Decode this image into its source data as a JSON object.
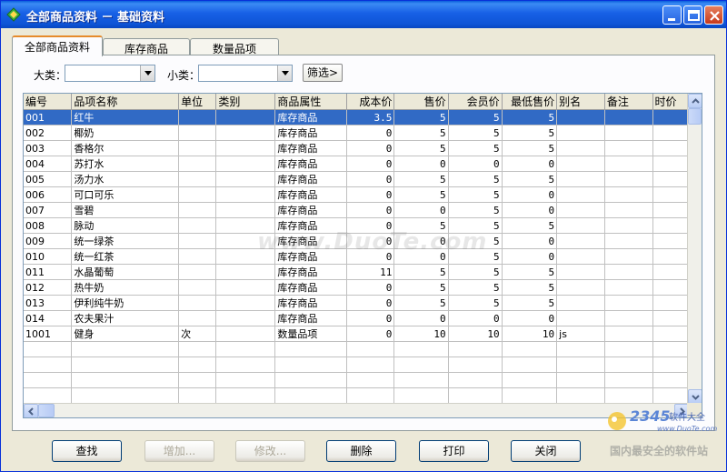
{
  "window": {
    "title": "全部商品资料 － 基础资料"
  },
  "tabs": [
    {
      "label": "全部商品资料",
      "active": true
    },
    {
      "label": "库存商品",
      "active": false
    },
    {
      "label": "数量品项",
      "active": false
    }
  ],
  "filters": {
    "major_label": "大类：",
    "major_value": "",
    "minor_label": "小类：",
    "minor_value": "",
    "filter_button": "筛选>"
  },
  "grid": {
    "columns": [
      "编号",
      "品项名称",
      "单位",
      "类别",
      "商品属性",
      "成本价",
      "售价",
      "会员价",
      "最低售价",
      "别名",
      "备注",
      "时价"
    ],
    "rows": [
      {
        "code": "001",
        "name": "红牛",
        "unit": "",
        "category": "",
        "attr": "库存商品",
        "cost": "3.5",
        "price": "5",
        "member": "5",
        "min": "5",
        "alias": "",
        "note": "",
        "timeprice": "",
        "selected": true
      },
      {
        "code": "002",
        "name": "椰奶",
        "unit": "",
        "category": "",
        "attr": "库存商品",
        "cost": "0",
        "price": "5",
        "member": "5",
        "min": "5",
        "alias": "",
        "note": "",
        "timeprice": ""
      },
      {
        "code": "003",
        "name": "香格尔",
        "unit": "",
        "category": "",
        "attr": "库存商品",
        "cost": "0",
        "price": "5",
        "member": "5",
        "min": "5",
        "alias": "",
        "note": "",
        "timeprice": ""
      },
      {
        "code": "004",
        "name": "苏打水",
        "unit": "",
        "category": "",
        "attr": "库存商品",
        "cost": "0",
        "price": "0",
        "member": "0",
        "min": "0",
        "alias": "",
        "note": "",
        "timeprice": ""
      },
      {
        "code": "005",
        "name": "汤力水",
        "unit": "",
        "category": "",
        "attr": "库存商品",
        "cost": "0",
        "price": "5",
        "member": "5",
        "min": "5",
        "alias": "",
        "note": "",
        "timeprice": ""
      },
      {
        "code": "006",
        "name": "可口可乐",
        "unit": "",
        "category": "",
        "attr": "库存商品",
        "cost": "0",
        "price": "5",
        "member": "5",
        "min": "0",
        "alias": "",
        "note": "",
        "timeprice": ""
      },
      {
        "code": "007",
        "name": "雪碧",
        "unit": "",
        "category": "",
        "attr": "库存商品",
        "cost": "0",
        "price": "0",
        "member": "5",
        "min": "0",
        "alias": "",
        "note": "",
        "timeprice": ""
      },
      {
        "code": "008",
        "name": "脉动",
        "unit": "",
        "category": "",
        "attr": "库存商品",
        "cost": "0",
        "price": "5",
        "member": "5",
        "min": "5",
        "alias": "",
        "note": "",
        "timeprice": ""
      },
      {
        "code": "009",
        "name": "统一绿茶",
        "unit": "",
        "category": "",
        "attr": "库存商品",
        "cost": "0",
        "price": "0",
        "member": "5",
        "min": "0",
        "alias": "",
        "note": "",
        "timeprice": ""
      },
      {
        "code": "010",
        "name": "统一红茶",
        "unit": "",
        "category": "",
        "attr": "库存商品",
        "cost": "0",
        "price": "0",
        "member": "5",
        "min": "0",
        "alias": "",
        "note": "",
        "timeprice": ""
      },
      {
        "code": "011",
        "name": "水晶葡萄",
        "unit": "",
        "category": "",
        "attr": "库存商品",
        "cost": "11",
        "price": "5",
        "member": "5",
        "min": "5",
        "alias": "",
        "note": "",
        "timeprice": ""
      },
      {
        "code": "012",
        "name": "热牛奶",
        "unit": "",
        "category": "",
        "attr": "库存商品",
        "cost": "0",
        "price": "5",
        "member": "5",
        "min": "5",
        "alias": "",
        "note": "",
        "timeprice": ""
      },
      {
        "code": "013",
        "name": "伊利纯牛奶",
        "unit": "",
        "category": "",
        "attr": "库存商品",
        "cost": "0",
        "price": "5",
        "member": "5",
        "min": "5",
        "alias": "",
        "note": "",
        "timeprice": ""
      },
      {
        "code": "014",
        "name": "农夫果汁",
        "unit": "",
        "category": "",
        "attr": "库存商品",
        "cost": "0",
        "price": "0",
        "member": "0",
        "min": "0",
        "alias": "",
        "note": "",
        "timeprice": ""
      },
      {
        "code": "1001",
        "name": "健身",
        "unit": "次",
        "category": "",
        "attr": "数量品项",
        "cost": "0",
        "price": "10",
        "member": "10",
        "min": "10",
        "alias": "js",
        "note": "",
        "timeprice": ""
      }
    ],
    "empty_rows": 5
  },
  "watermark": "www.DuoTe.com",
  "corner_logo": {
    "number": "2345",
    "text": "软件大全",
    "url": "www.DuoTe.com",
    "tagline": "国内最安全的软件站"
  },
  "buttons": [
    {
      "label": "查找",
      "enabled": true,
      "name": "find-button"
    },
    {
      "label": "增加...",
      "enabled": false,
      "name": "add-button"
    },
    {
      "label": "修改...",
      "enabled": false,
      "name": "edit-button"
    },
    {
      "label": "删除",
      "enabled": true,
      "name": "delete-button"
    },
    {
      "label": "打印",
      "enabled": true,
      "name": "print-button"
    },
    {
      "label": "关闭",
      "enabled": true,
      "name": "close-dialog-button"
    }
  ],
  "colors": {
    "titlebar": "#0e54d6",
    "selection": "#316ac5",
    "tab_accent": "#e68b2c"
  }
}
